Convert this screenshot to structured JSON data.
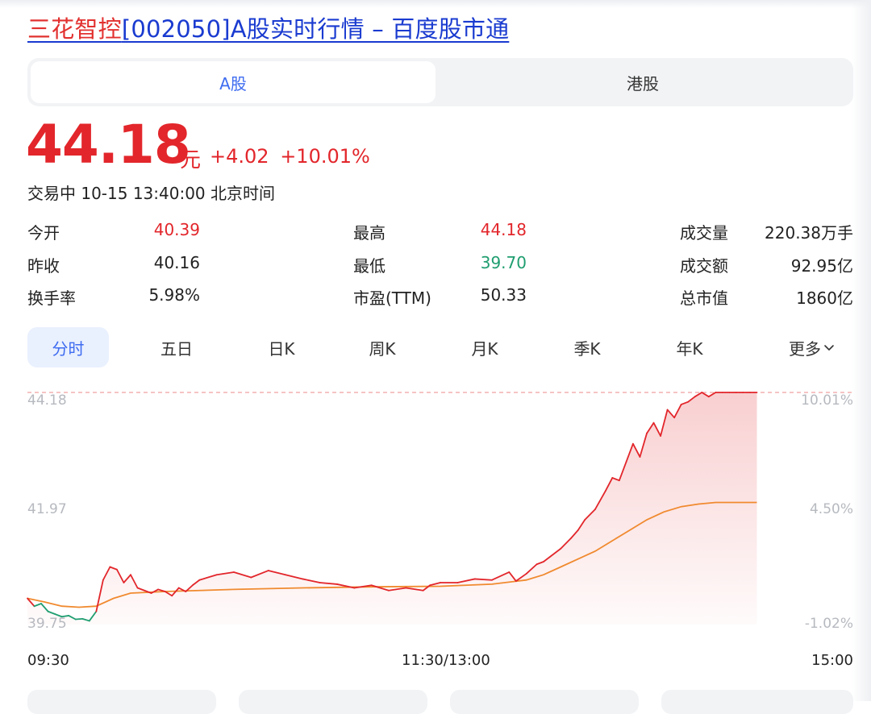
{
  "title": {
    "stock_name": "三花智控",
    "rest": "[002050]A股实时行情 – 百度股市通"
  },
  "market_tabs": {
    "a_share": "A股",
    "hk_share": "港股",
    "active": "A股"
  },
  "quote": {
    "price": "44.18",
    "unit": "元",
    "change": "+4.02",
    "change_pct": "+10.01%",
    "status": "交易中 10-15 13:40:00 北京时间"
  },
  "stats": {
    "open_label": "今开",
    "open_value": "40.39",
    "prev_close_label": "昨收",
    "prev_close_value": "40.16",
    "turnover_label": "换手率",
    "turnover_value": "5.98%",
    "high_label": "最高",
    "high_value": "44.18",
    "low_label": "最低",
    "low_value": "39.70",
    "pe_label": "市盈(TTM)",
    "pe_value": "50.33",
    "volume_label": "成交量",
    "volume_value": "220.38万手",
    "amount_label": "成交额",
    "amount_value": "92.95亿",
    "mktcap_label": "总市值",
    "mktcap_value": "1860亿"
  },
  "period_tabs": [
    "分时",
    "五日",
    "日K",
    "周K",
    "月K",
    "季K",
    "年K",
    "更多"
  ],
  "colors": {
    "up": "#e2262b",
    "down": "#1f9e70",
    "accent": "#3e6cf0",
    "avg_line": "#f08a2f"
  },
  "chart_data": {
    "type": "line",
    "y_left_ticks": [
      "44.18",
      "41.97",
      "39.75"
    ],
    "y_right_ticks": [
      "10.01%",
      "4.50%",
      "-1.02%"
    ],
    "x_ticks": [
      "09:30",
      "11:30/13:00",
      "15:00"
    ],
    "ylim": [
      39.75,
      44.18
    ],
    "prev_close": 40.16,
    "total_minutes": 240,
    "series": [
      {
        "minutes": [
          0,
          2,
          4,
          6,
          8,
          10,
          12,
          14,
          16,
          18,
          20,
          22,
          24,
          26,
          28,
          30,
          32,
          34,
          36,
          38,
          40,
          42,
          44,
          46,
          48,
          50,
          55,
          60,
          65,
          70,
          75,
          80,
          85,
          90,
          95,
          100,
          105,
          110,
          115,
          117,
          120,
          125,
          130,
          135,
          140,
          142,
          145,
          148,
          150,
          152,
          155,
          158,
          160,
          162,
          165,
          168,
          170,
          172,
          174,
          176,
          178,
          180,
          182,
          184,
          186,
          188,
          190,
          192,
          194,
          196,
          198,
          200,
          202,
          204,
          206,
          208,
          210,
          212
        ],
        "values": [
          40.25,
          40.1,
          40.15,
          40.0,
          39.95,
          39.9,
          39.92,
          39.85,
          39.86,
          39.82,
          40.0,
          40.6,
          40.85,
          40.8,
          40.55,
          40.7,
          40.45,
          40.4,
          40.35,
          40.42,
          40.38,
          40.3,
          40.45,
          40.38,
          40.5,
          40.6,
          40.7,
          40.75,
          40.65,
          40.78,
          40.7,
          40.62,
          40.55,
          40.52,
          40.45,
          40.5,
          40.4,
          40.45,
          40.4,
          40.5,
          40.55,
          40.55,
          40.62,
          40.6,
          40.75,
          40.58,
          40.72,
          40.9,
          40.95,
          41.05,
          41.2,
          41.4,
          41.55,
          41.75,
          41.95,
          42.3,
          42.55,
          42.5,
          42.85,
          43.2,
          42.95,
          43.4,
          43.6,
          43.35,
          43.85,
          43.7,
          43.95,
          44.0,
          44.1,
          44.18,
          44.1,
          44.18,
          44.18,
          44.18,
          44.18,
          44.18,
          44.18,
          44.18
        ]
      },
      {
        "minutes": [
          0,
          5,
          10,
          15,
          20,
          25,
          30,
          40,
          60,
          80,
          100,
          120,
          135,
          145,
          150,
          155,
          160,
          165,
          170,
          175,
          180,
          185,
          190,
          195,
          200,
          212
        ],
        "values": [
          40.25,
          40.18,
          40.1,
          40.08,
          40.1,
          40.25,
          40.35,
          40.38,
          40.42,
          40.45,
          40.47,
          40.48,
          40.52,
          40.6,
          40.7,
          40.85,
          41.0,
          41.15,
          41.35,
          41.55,
          41.75,
          41.9,
          42.0,
          42.05,
          42.08,
          42.08
        ]
      }
    ]
  }
}
